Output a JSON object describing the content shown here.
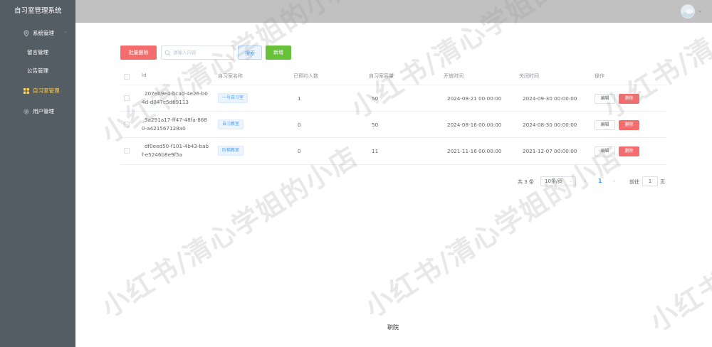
{
  "app": {
    "title": "自习室管理系统"
  },
  "sidebar": {
    "items": [
      {
        "label": "系统管理",
        "icon": "location-pin-icon",
        "expandable": true
      },
      {
        "label": "留言管理"
      },
      {
        "label": "公告管理"
      },
      {
        "label": "自习室管理",
        "icon": "grid-icon",
        "active": true
      },
      {
        "label": "用户管理",
        "icon": "gear-icon"
      }
    ]
  },
  "header": {
    "avatar_icon": "avatar-icon",
    "dropdown_icon": "chevron-down-icon"
  },
  "toolbar": {
    "batch_delete_label": "批量删除",
    "search_placeholder": "请输入内容",
    "search_value": "",
    "search_label": "搜索",
    "add_label": "新增"
  },
  "table": {
    "columns": [
      "Id",
      "自习室名称",
      "已预约人数",
      "自习室容量",
      "开放时间",
      "关闭时间",
      "操作"
    ],
    "rows": [
      {
        "id": "207eb9e4-bcad-4e26-b04d-d047c5d69113",
        "name": "一号自习室",
        "booked": "1",
        "capacity": "50",
        "open_time": "2024-08-21 00:00:00",
        "close_time": "2024-09-30 00:00:00",
        "edit": "编辑",
        "delete": "删除"
      },
      {
        "id": "5a291a17-ff47-48fa-8680-a421567128a0",
        "name": "自习教室",
        "booked": "0",
        "capacity": "50",
        "open_time": "2024-08-16 00:00:00",
        "close_time": "2024-08-30 00:00:00",
        "edit": "编辑",
        "delete": "删除"
      },
      {
        "id": "df0eed50-f101-4b43-babf-e5246b8e9f5a",
        "name": "阶梯教室",
        "booked": "0",
        "capacity": "11",
        "open_time": "2021-11-16 00:00:00",
        "close_time": "2021-12-07 00:00:00",
        "edit": "编辑",
        "delete": "删除"
      }
    ]
  },
  "pagination": {
    "total_label": "共 3 条",
    "page_size": "10条/页",
    "current_page": "1",
    "goto_label": "前往",
    "goto_value": "1",
    "goto_unit": "页"
  },
  "footer": {
    "text": "职院"
  },
  "watermark": {
    "text": "小红书/清心学姐的小店"
  },
  "colors": {
    "sidebar_bg": "#545c64",
    "header_bg": "#c1c1c1",
    "active": "#ffd04b",
    "danger": "#f56c6c",
    "success": "#67c23a",
    "primary": "#409eff"
  }
}
